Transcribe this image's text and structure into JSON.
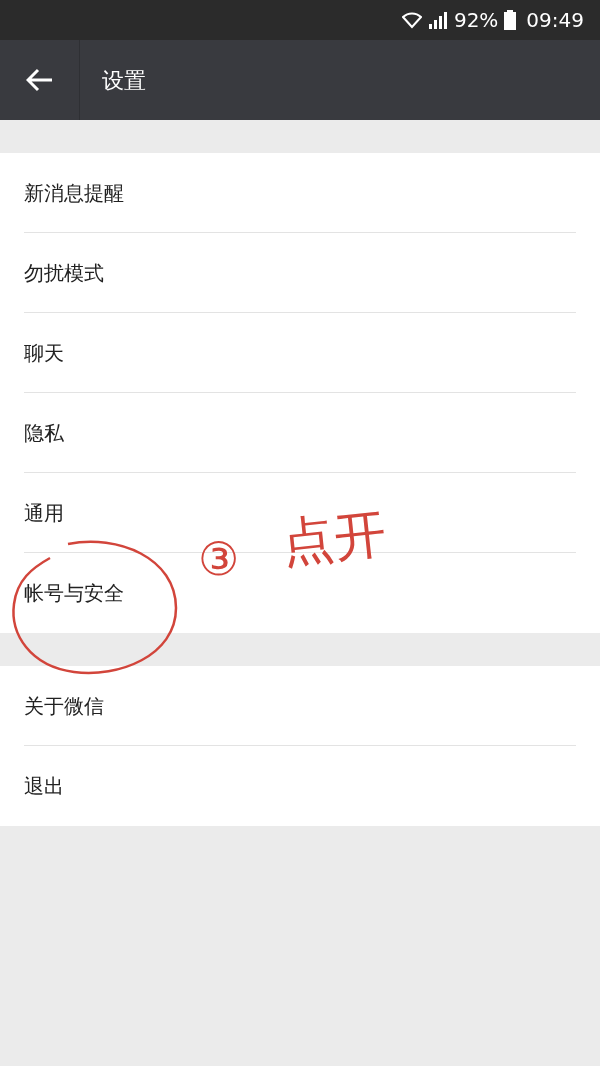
{
  "status_bar": {
    "battery": "92%",
    "time": "09:49"
  },
  "header": {
    "title": "设置"
  },
  "groups": [
    {
      "items": [
        {
          "label": "新消息提醒"
        },
        {
          "label": "勿扰模式"
        },
        {
          "label": "聊天"
        },
        {
          "label": "隐私"
        },
        {
          "label": "通用"
        },
        {
          "label": "帐号与安全"
        }
      ]
    },
    {
      "items": [
        {
          "label": "关于微信"
        },
        {
          "label": "退出"
        }
      ]
    }
  ],
  "annotation": {
    "number": "③",
    "text": "点开"
  }
}
